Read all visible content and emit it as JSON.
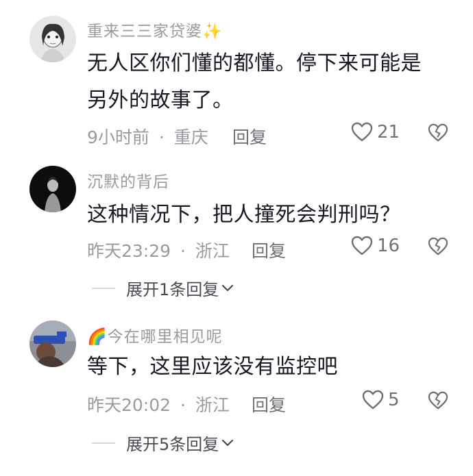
{
  "comments": [
    {
      "username": "重来三三家贷婆",
      "username_suffix": "✨",
      "content_lines": [
        "无人区你们懂的都懂。停下来可能是",
        "另外的故事了。"
      ],
      "time": "9小时前",
      "location": "重庆",
      "separator": "·",
      "reply_label": "回复",
      "likes": "21",
      "icons": {
        "like": "heart-outline-icon",
        "dislike": "broken-heart-icon"
      }
    },
    {
      "username": "沉默的背后",
      "content_lines": [
        "这种情况下，把人撞死会判刑吗？"
      ],
      "time": "昨天23:29",
      "location": "浙江",
      "separator": "·",
      "reply_label": "回复",
      "likes": "16",
      "expand_label": "展开1条回复",
      "icons": {
        "like": "heart-outline-icon",
        "dislike": "broken-heart-icon",
        "expand": "chevron-down-icon"
      }
    },
    {
      "username_prefix": "🌈",
      "username": "今在哪里相见呢",
      "content_lines": [
        "等下，这里应该没有监控吧"
      ],
      "time": "昨天20:02",
      "location": "浙江",
      "separator": "·",
      "reply_label": "回复",
      "likes": "5",
      "expand_label": "展开5条回复",
      "icons": {
        "like": "heart-outline-icon",
        "dislike": "broken-heart-icon",
        "expand": "chevron-down-icon"
      }
    }
  ]
}
